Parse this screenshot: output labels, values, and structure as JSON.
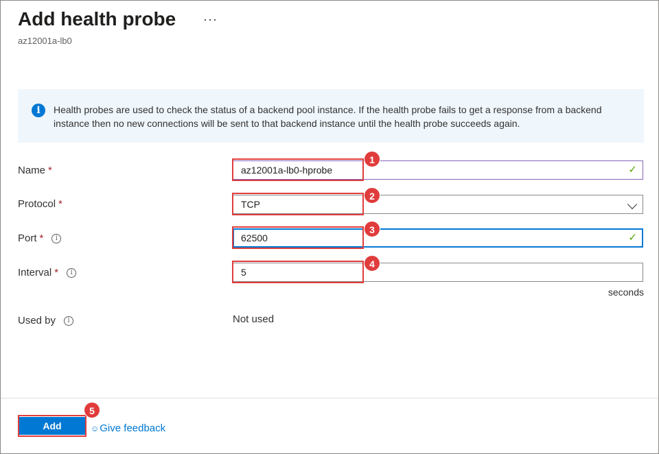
{
  "header": {
    "title": "Add health probe",
    "more_label": "···",
    "subtitle": "az12001a-lb0"
  },
  "info": {
    "icon": "info-icon",
    "text": "Health probes are used to check the status of a backend pool instance. If the health probe fails to get a response from a backend instance then no new connections will be sent to that backend instance until the health probe succeeds again."
  },
  "form": {
    "name": {
      "label": "Name",
      "required": "*",
      "value": "az12001a-lb0-hprobe",
      "valid": "✓"
    },
    "protocol": {
      "label": "Protocol",
      "required": "*",
      "value": "TCP"
    },
    "port": {
      "label": "Port",
      "required": "*",
      "info": "i",
      "value": "62500",
      "valid": "✓"
    },
    "interval": {
      "label": "Interval",
      "required": "*",
      "info": "i",
      "value": "5",
      "unit": "seconds"
    },
    "used_by": {
      "label": "Used by",
      "info": "i",
      "value": "Not used"
    }
  },
  "footer": {
    "add_label": "Add",
    "feedback_icon": "feedback-icon",
    "feedback_label": "Give feedback"
  },
  "annotations": [
    "1",
    "2",
    "3",
    "4",
    "5"
  ],
  "colors": {
    "accent": "#0078d4",
    "highlight": "#e03c3c",
    "valid": "#57a300",
    "focus_border": "#0078d4",
    "name_border": "#8764b8"
  }
}
